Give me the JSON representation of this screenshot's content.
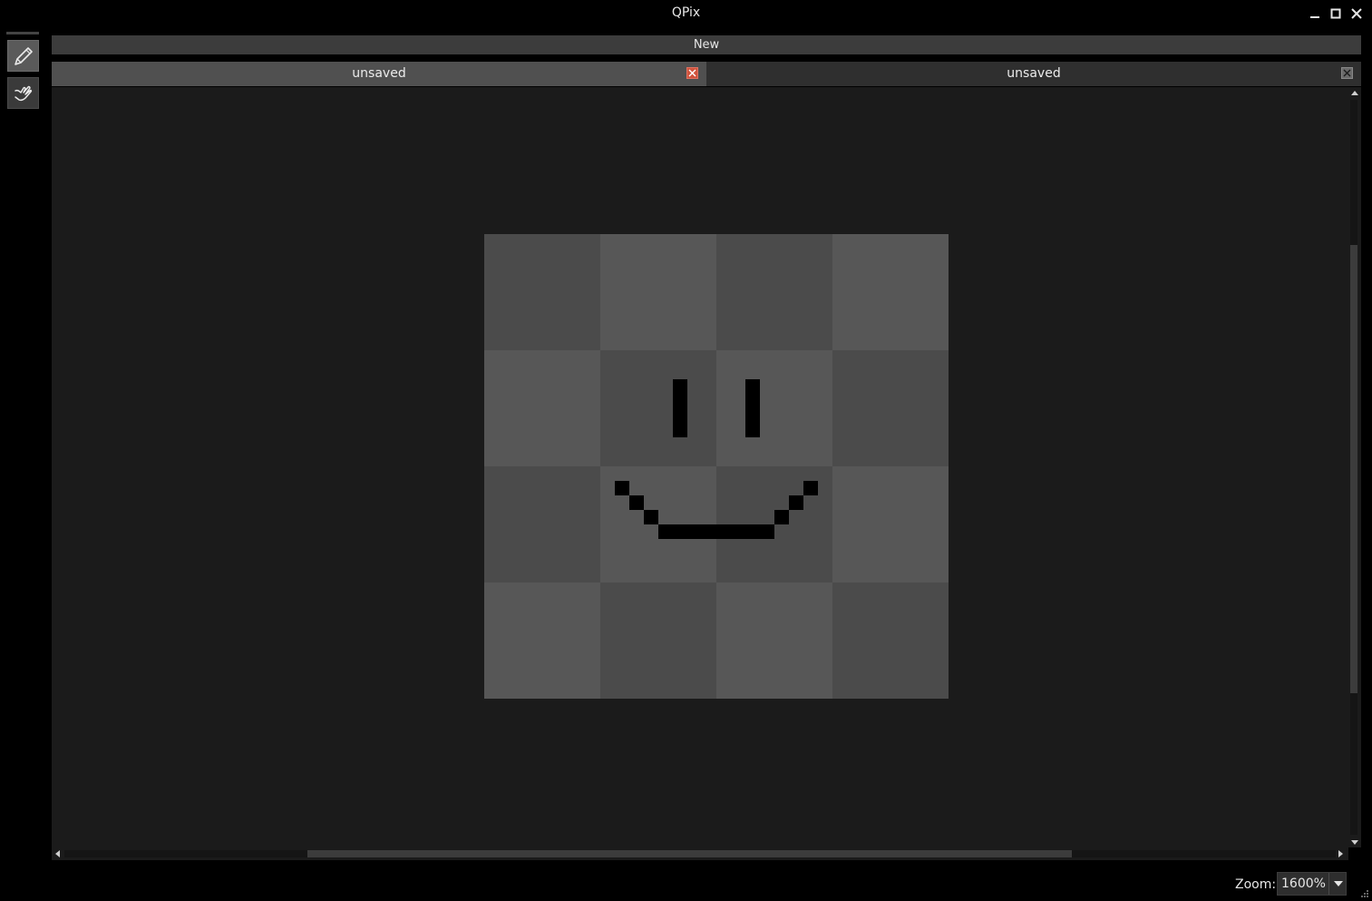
{
  "window": {
    "title": "QPix"
  },
  "toolbar": {
    "tools": [
      {
        "name": "pencil",
        "active": true
      },
      {
        "name": "pan",
        "active": false
      }
    ]
  },
  "actions": {
    "new_label": "New"
  },
  "tabs": [
    {
      "label": "unsaved",
      "active": true
    },
    {
      "label": "unsaved",
      "active": false
    }
  ],
  "canvas": {
    "checker_colors": [
      "#4b4b4b",
      "#575757"
    ],
    "drawing": "smiley face"
  },
  "status": {
    "zoom_label": "Zoom:",
    "zoom_value": "1600%"
  },
  "colors": {
    "background": "#000000",
    "canvas_bg": "#1b1b1b",
    "tab_active": "#505050",
    "tab_inactive": "#2f2f2f",
    "close_active": "#d0543d"
  }
}
